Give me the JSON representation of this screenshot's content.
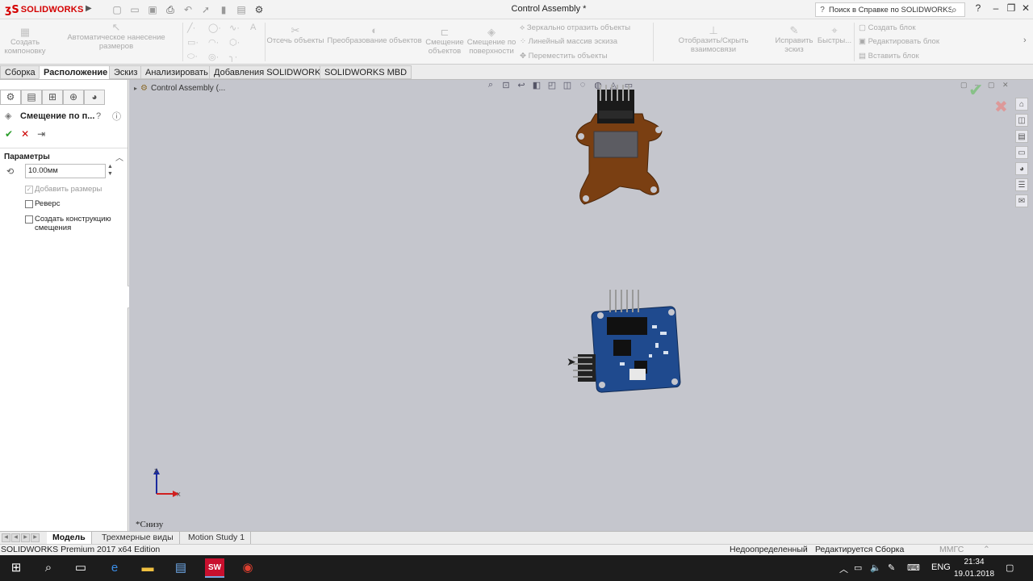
{
  "app": {
    "logo_text": "SOLIDWORKS",
    "window_title": "Control Assembly *",
    "help_search_placeholder": "Поиск в Справке по SOLIDWORKS"
  },
  "command_manager": {
    "create_layout": "Создать компоновку",
    "auto_dimension": "Автоматическое нанесение размеров",
    "trim_entities": "Отсечь объекты",
    "convert_entities": "Преобразование объектов",
    "offset_entities": "Смещение объектов",
    "offset_on_surface": "Смещение по поверхности",
    "mirror_entities": "Зеркально отразить объекты",
    "linear_pattern": "Линейный массив эскиза",
    "move_entities": "Переместить объекты",
    "display_relations": "Отобразить/Скрыть взаимосвязи",
    "repair_sketch": "Исправить эскиз",
    "quick_snaps": "Быстры...",
    "make_block": "Создать блок",
    "edit_block": "Редактировать блок",
    "insert_block": "Вставить блок"
  },
  "tabs": [
    "Сборка",
    "Расположение",
    "Эскиз",
    "Анализировать",
    "Добавления SOLIDWORKS",
    "SOLIDWORKS MBD"
  ],
  "property_manager": {
    "title": "Смещение по п...",
    "section": "Параметры",
    "offset_value": "10.00мм",
    "checkbox_add_dims": "Добавить размеры",
    "checkbox_reverse": "Реверс",
    "checkbox_construction": "Создать конструкцию смещения"
  },
  "viewport": {
    "tree_root": "Control Assembly  (...",
    "view_name": "*Снизу",
    "triad_x": "X",
    "triad_z": "Z"
  },
  "bottom_tabs": [
    "Модель",
    "Трехмерные виды",
    "Motion Study 1"
  ],
  "status": {
    "edition": "SOLIDWORKS Premium 2017 x64 Edition",
    "definition": "Недоопределенный",
    "editing": "Редактируется Сборка",
    "units": "ММГС"
  },
  "taskbar": {
    "lang": "ENG",
    "time": "21:34",
    "date": "19.01.2018"
  },
  "colors": {
    "brand": "#d40000",
    "viewport_bg": "#c5c6cd",
    "pcb_blue": "#1f4a8e",
    "bracket_brown": "#7a3f12"
  }
}
